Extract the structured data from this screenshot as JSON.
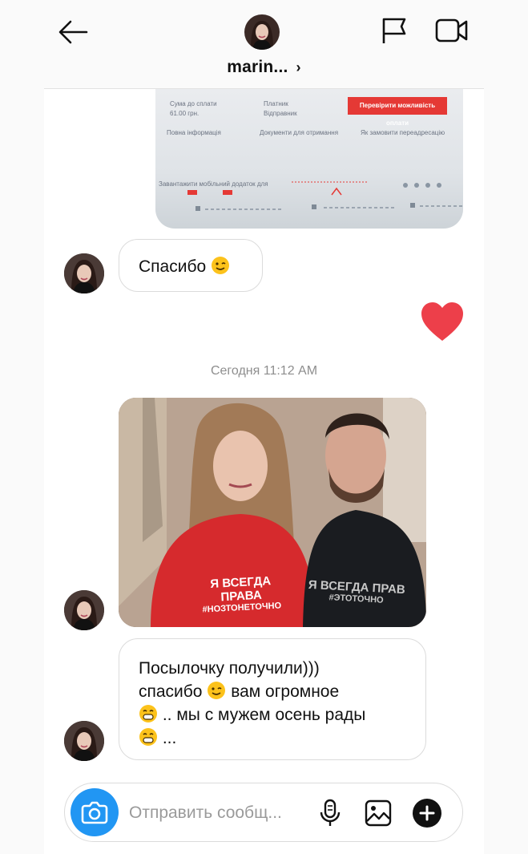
{
  "header": {
    "username": "marin...",
    "chevron": "›"
  },
  "doc_photo": {
    "amount_label": "Сума до сплати",
    "amount_value": "61.00 грн.",
    "payer_label": "Платник",
    "payer_value": "Відправник",
    "check_button": "Перевірити можливість оплати",
    "full_info": "Повна інформація",
    "docs": "Документи для отримання",
    "redirect": "Як замовити переадресацію",
    "download": "Завантажити мобільний додаток для"
  },
  "messages": [
    {
      "text": "Спасибо",
      "emoji": "wink-emoji"
    },
    {
      "lines": [
        "Посылочку получили)))",
        "спасибо",
        "вам огромное",
        ".. мы с мужем осень рады",
        "..."
      ]
    }
  ],
  "timestamp": "Сегодня 11:12 AM",
  "shirts": {
    "left_line1": "Я ВСЕГДА ПРАВА",
    "left_line2": "#НОЗТОНЕТОЧНО",
    "right_line1": "Я ВСЕГДА ПРАВ",
    "right_line2": "#ЭТОТОЧНО"
  },
  "composer": {
    "placeholder": "Отправить сообщ..."
  },
  "colors": {
    "accent_blue": "#2196f3",
    "heart_red": "#ed3f4a",
    "timestamp_gray": "#8e8e8e"
  },
  "icons": [
    "back-arrow-icon",
    "flag-icon",
    "video-camera-icon",
    "camera-icon",
    "microphone-icon",
    "gallery-icon",
    "plus-icon",
    "heart-icon"
  ]
}
